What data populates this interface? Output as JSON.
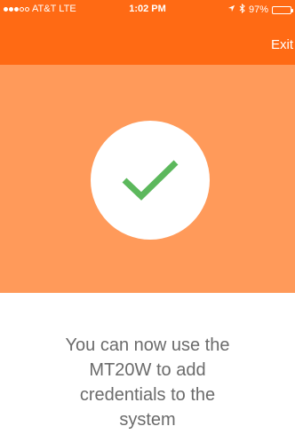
{
  "status_bar": {
    "carrier": "AT&T",
    "network": "LTE",
    "time": "1:02 PM",
    "battery": "97%",
    "signal_bars_filled": 3,
    "signal_bars_total": 5,
    "battery_level": 0.97
  },
  "nav": {
    "exit_label": "Exit"
  },
  "hero": {
    "icon": "check-icon",
    "check_color": "#5cb85c"
  },
  "message": {
    "lines": [
      "You can now use the",
      "MT20W to add",
      "credentials to the",
      "system"
    ]
  },
  "colors": {
    "header": "#ff6a14",
    "hero": "#ff9a5a",
    "text": "#6b6b6b"
  }
}
